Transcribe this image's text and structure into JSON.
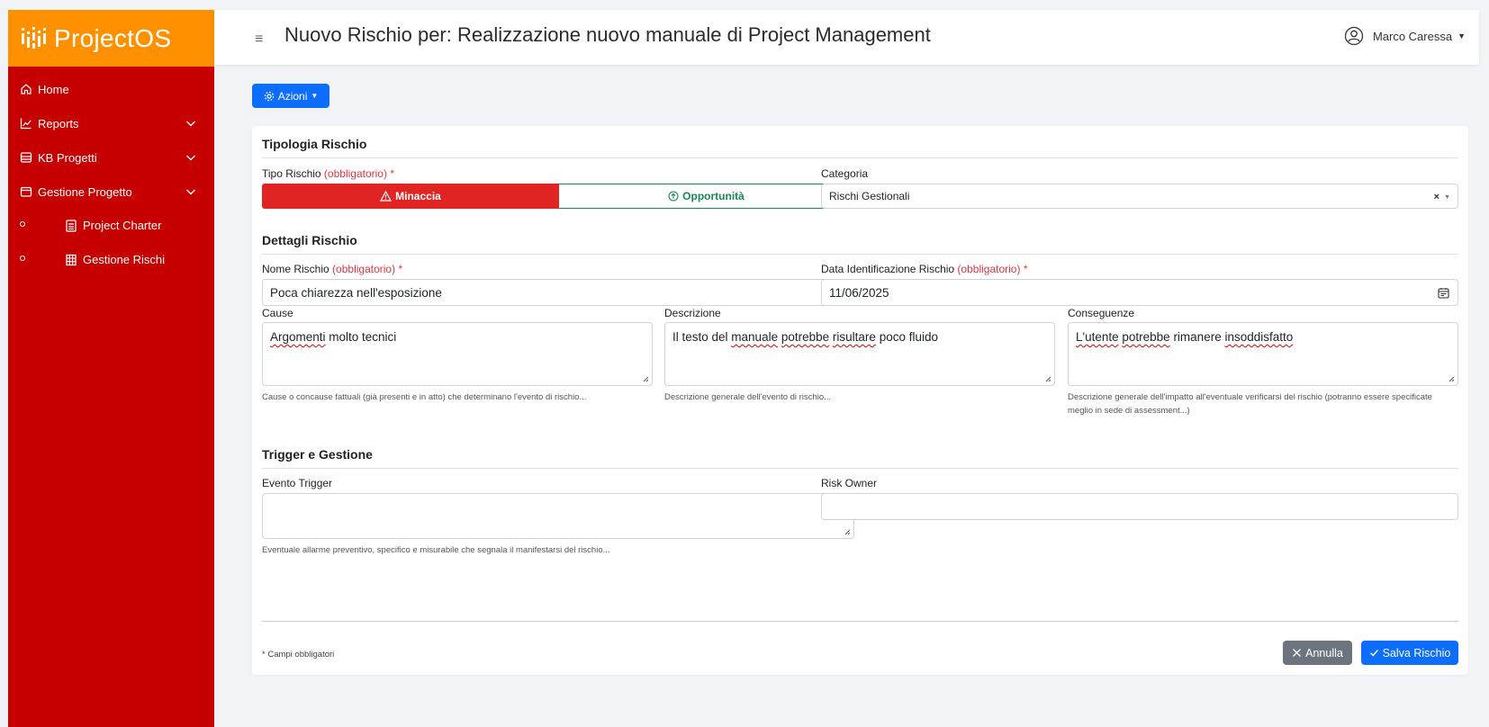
{
  "app": {
    "name": "ProjectOS"
  },
  "sidebar": {
    "items": [
      {
        "label": "Home",
        "icon": "home-icon"
      },
      {
        "label": "Reports",
        "icon": "chart-line-icon"
      },
      {
        "label": "KB Progetti",
        "icon": "database-icon"
      },
      {
        "label": "Gestione Progetto",
        "icon": "folder-icon"
      }
    ],
    "subitems": [
      {
        "label": "Project Charter",
        "icon": "file-text-icon"
      },
      {
        "label": "Gestione Rischi",
        "icon": "table-icon"
      }
    ]
  },
  "header": {
    "title": "Nuovo Rischio per: Realizzazione nuovo manuale di Project Management",
    "user_name": "Marco Caressa"
  },
  "toolbar": {
    "actions_label": "Azioni"
  },
  "form": {
    "section_tipologia": "Tipologia Rischio",
    "tipo_label": "Tipo Rischio",
    "required_mark": "(obbligatorio)",
    "asterisk": "*",
    "minaccia_label": "Minaccia",
    "opportunita_label": "Opportunità",
    "categoria_label": "Categoria",
    "categoria_value": "Rischi Gestionali",
    "section_dettagli": "Dettagli Rischio",
    "nome_label": "Nome Rischio",
    "nome_value": "Poca chiarezza nell'esposizione",
    "data_label": "Data Identificazione Rischio",
    "data_value": "11/06/2025",
    "cause_label": "Cause",
    "cause_value_a": "Argomenti",
    "cause_value_b": " molto tecnici",
    "cause_help": "Cause o concause fattuali (già presenti e in atto) che determinano l'evento di rischio...",
    "descrizione_label": "Descrizione",
    "descrizione_value_a": "Il testo del ",
    "descrizione_value_b": "manuale",
    "descrizione_value_c": " ",
    "descrizione_value_d": "potrebbe",
    "descrizione_value_e": " ",
    "descrizione_value_f": "risultare",
    "descrizione_value_g": " poco fluido",
    "descrizione_help": "Descrizione generale dell'evento di rischio...",
    "conseguenze_label": "Conseguenze",
    "conseguenze_value_a": "L'utente",
    "conseguenze_value_b": " ",
    "conseguenze_value_c": "potrebbe",
    "conseguenze_value_d": " rimanere ",
    "conseguenze_value_e": "insoddisfatto",
    "conseguenze_help": "Descrizione generale dell'impatto all'eventuale verificarsi del rischio (potranno essere specificate meglio in sede di assessment...)",
    "section_trigger": "Trigger e Gestione",
    "evento_label": "Evento Trigger",
    "evento_value": "",
    "evento_help": "Eventuale allarme preventivo, specifico e misurabile che segnala il manifestarsi del rischio...",
    "owner_label": "Risk Owner",
    "owner_value": "",
    "footer_note": "* Campi obbligatori",
    "cancel_label": "Annulla",
    "save_label": "Salva Rischio"
  },
  "colors": {
    "sidebar": "#c60000",
    "brand": "#ff9000",
    "primary": "#0d6efd",
    "danger": "#e02424",
    "success": "#198754",
    "secondary": "#6c757d"
  }
}
